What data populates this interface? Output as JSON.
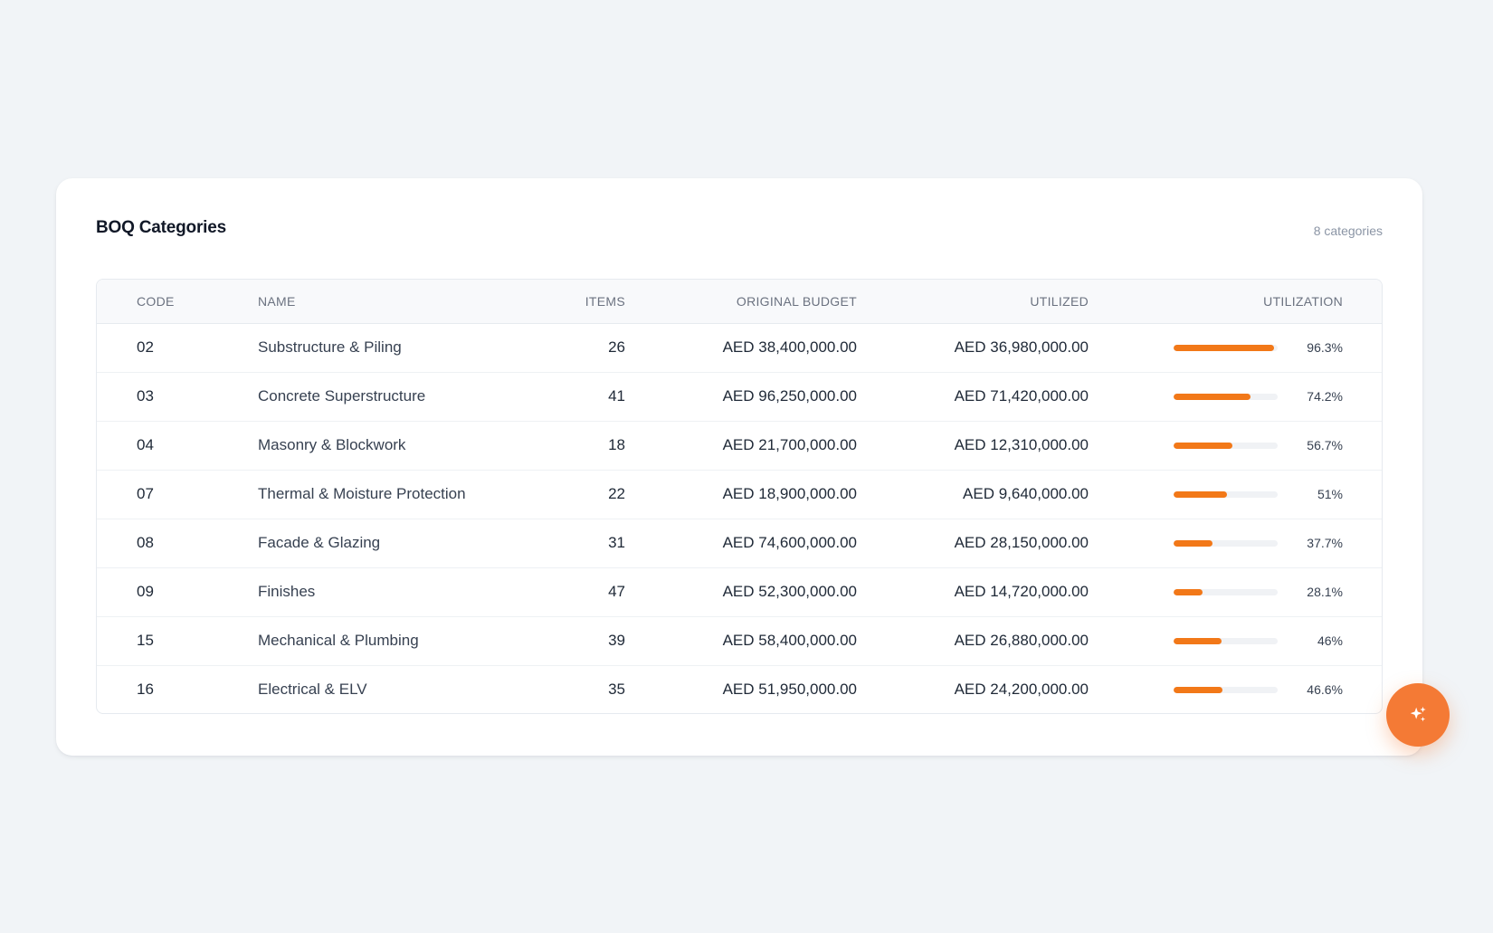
{
  "card": {
    "title": "BOQ Categories",
    "count": "8 categories"
  },
  "table": {
    "headers": {
      "code": "CODE",
      "name": "NAME",
      "items": "ITEMS",
      "original_budget": "ORIGINAL BUDGET",
      "utilized": "UTILIZED",
      "utilization": "UTILIZATION"
    },
    "rows": [
      {
        "code": "02",
        "name": "Substructure & Piling",
        "items": "26",
        "original_budget": "AED 38,400,000.00",
        "utilized": "AED 36,980,000.00",
        "utilization": "96.3%",
        "utilization_value": 96.3
      },
      {
        "code": "03",
        "name": "Concrete Superstructure",
        "items": "41",
        "original_budget": "AED 96,250,000.00",
        "utilized": "AED 71,420,000.00",
        "utilization": "74.2%",
        "utilization_value": 74.2
      },
      {
        "code": "04",
        "name": "Masonry & Blockwork",
        "items": "18",
        "original_budget": "AED 21,700,000.00",
        "utilized": "AED 12,310,000.00",
        "utilization": "56.7%",
        "utilization_value": 56.7
      },
      {
        "code": "07",
        "name": "Thermal & Moisture Protection",
        "items": "22",
        "original_budget": "AED 18,900,000.00",
        "utilized": "AED 9,640,000.00",
        "utilization": "51%",
        "utilization_value": 51
      },
      {
        "code": "08",
        "name": "Facade & Glazing",
        "items": "31",
        "original_budget": "AED 74,600,000.00",
        "utilized": "AED 28,150,000.00",
        "utilization": "37.7%",
        "utilization_value": 37.7
      },
      {
        "code": "09",
        "name": "Finishes",
        "items": "47",
        "original_budget": "AED 52,300,000.00",
        "utilized": "AED 14,720,000.00",
        "utilization": "28.1%",
        "utilization_value": 28.1
      },
      {
        "code": "15",
        "name": "Mechanical & Plumbing",
        "items": "39",
        "original_budget": "AED 58,400,000.00",
        "utilized": "AED 26,880,000.00",
        "utilization": "46%",
        "utilization_value": 46
      },
      {
        "code": "16",
        "name": "Electrical & ELV",
        "items": "35",
        "original_budget": "AED 51,950,000.00",
        "utilized": "AED 24,200,000.00",
        "utilization": "46.6%",
        "utilization_value": 46.6
      }
    ]
  },
  "colors": {
    "accent": "#f27818",
    "fab": "#f47a35",
    "track": "#f0f2f5"
  },
  "fab": {
    "icon": "sparkles-icon"
  }
}
